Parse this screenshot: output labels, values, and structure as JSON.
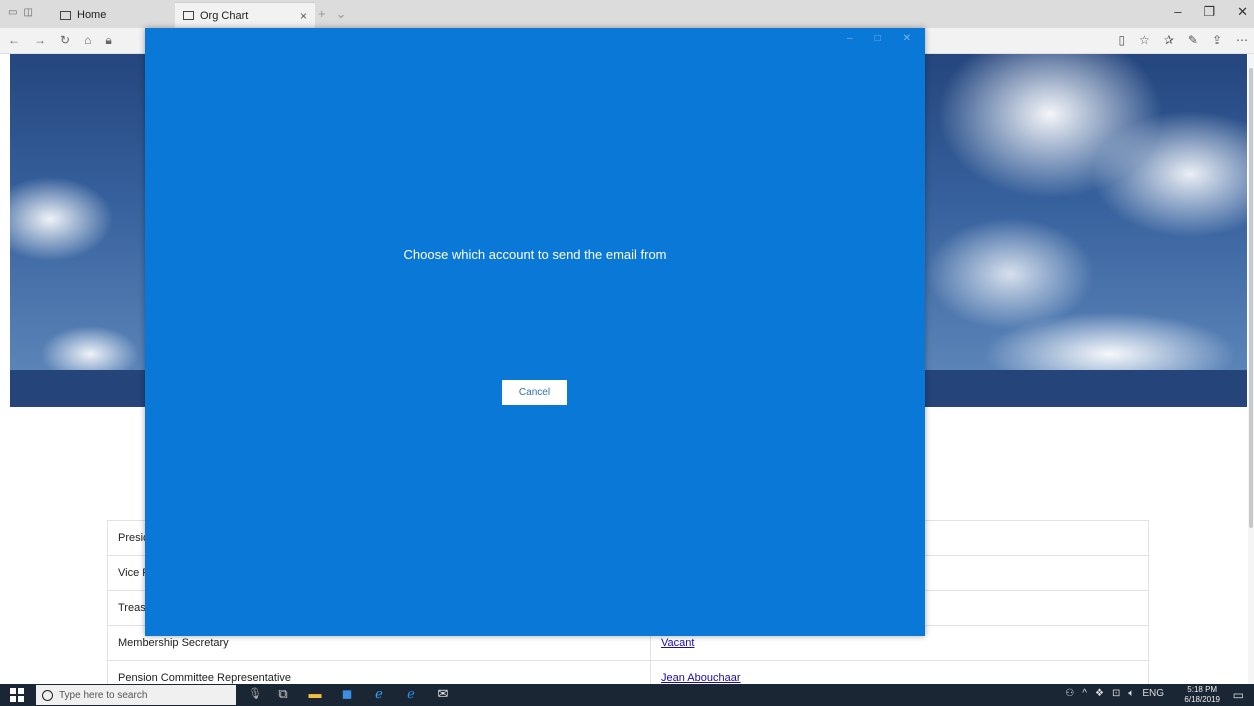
{
  "browser": {
    "tabs": [
      {
        "label": "Home"
      },
      {
        "label": "Org Chart"
      }
    ]
  },
  "table": {
    "rows": [
      {
        "role": "Presid",
        "member": ""
      },
      {
        "role": "Vice P",
        "member": ""
      },
      {
        "role": "Treas",
        "member": ""
      },
      {
        "role": "Membership Secretary",
        "member": "Vacant"
      },
      {
        "role": "Pension Committee Representative",
        "member": "Jean Abouchaar"
      }
    ]
  },
  "dialog": {
    "message": "Choose which account to send the email from",
    "cancel_label": "Cancel"
  },
  "taskbar": {
    "search_placeholder": "Type here to search",
    "language": "ENG",
    "time": "5:18 PM",
    "date": "6/18/2019"
  },
  "colors": {
    "dialog_bg": "#0a78d7",
    "band": "#24447a",
    "taskbar": "#1a2634"
  }
}
